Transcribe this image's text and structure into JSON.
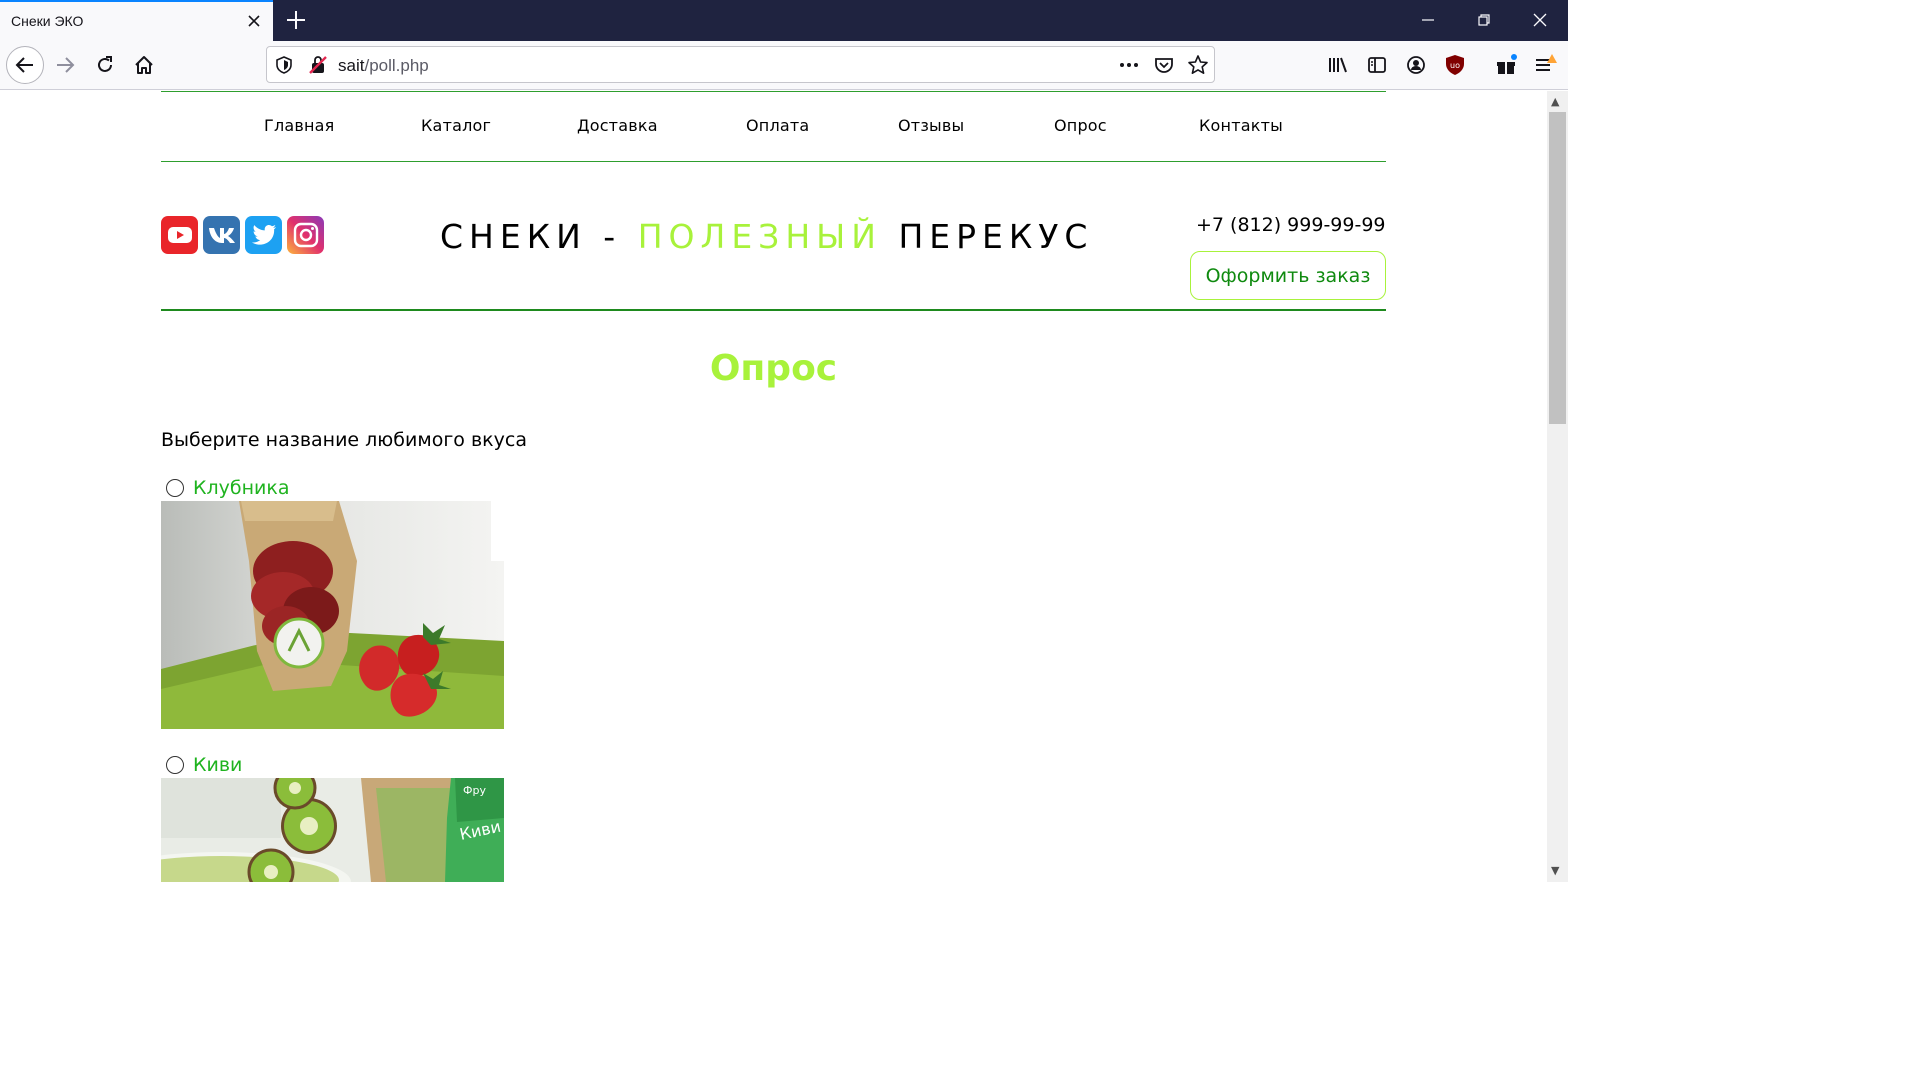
{
  "browser": {
    "tab_title": "Снеки ЭКО",
    "url_host": "sait",
    "url_path": "/poll.php"
  },
  "nav": {
    "items": [
      "Главная",
      "Каталог",
      "Доставка",
      "Оплата",
      "Отзывы",
      "Опрос",
      "Контакты"
    ]
  },
  "header": {
    "brand_part1": "СНЕКИ - ",
    "brand_accent": "ПОЛЕЗНЫЙ",
    "brand_part2": " ПЕРЕКУС",
    "phone": "+7 (812) 999-99-99",
    "order_button": "Оформить заказ",
    "socials": [
      "youtube-icon",
      "vk-icon",
      "twitter-icon",
      "instagram-icon"
    ]
  },
  "poll": {
    "title": "Опрос",
    "question": "Выберите название любимого вкуса",
    "options": [
      {
        "label": "Клубника",
        "selected": false
      },
      {
        "label": "Киви",
        "selected": false
      }
    ]
  },
  "colors": {
    "accent": "#a8f23b",
    "green_text": "#1fb31f",
    "line": "#2e9e2e"
  }
}
